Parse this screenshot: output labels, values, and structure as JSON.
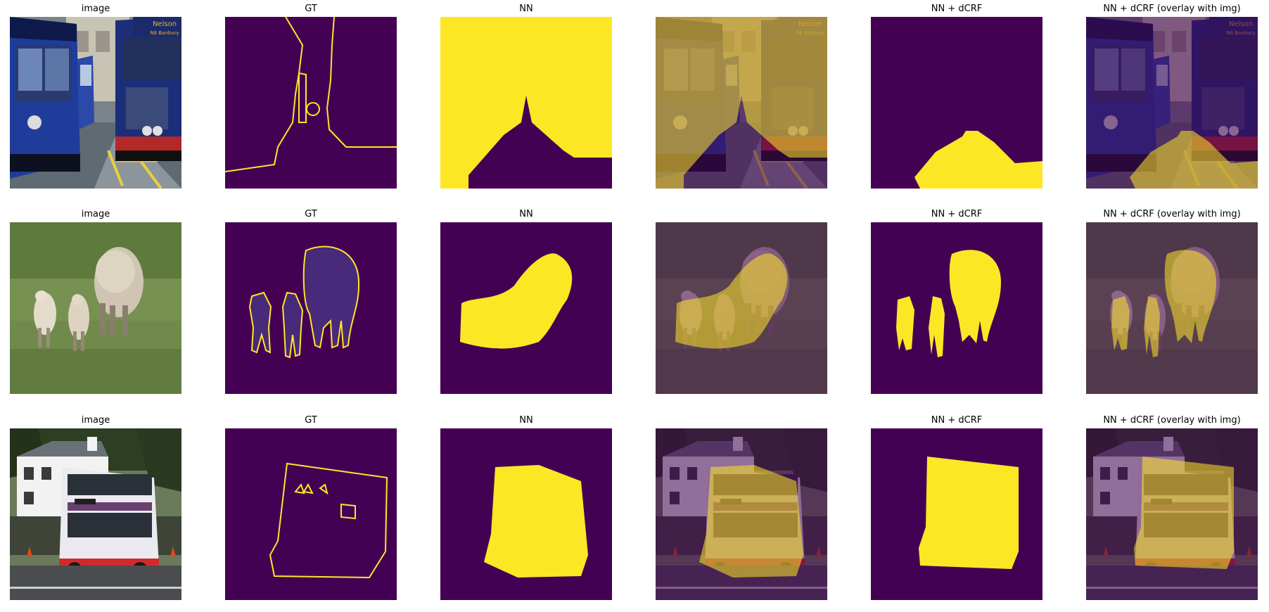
{
  "figure": {
    "columns": [
      {
        "key": "image",
        "title": "image"
      },
      {
        "key": "gt",
        "title": "GT"
      },
      {
        "key": "nn",
        "title": "NN"
      },
      {
        "key": "nn_overlay",
        "title": ""
      },
      {
        "key": "nn_dcrf",
        "title": "NN + dCRF"
      },
      {
        "key": "nn_dcrf_overlay",
        "title": "NN + dCRF (overlay with img)"
      }
    ],
    "rows": [
      {
        "subject": "buses"
      },
      {
        "subject": "sheep"
      },
      {
        "subject": "bus"
      }
    ],
    "bus_sign_text": "Nelson",
    "bus_route_text": "N8 Banbury",
    "colors": {
      "background_class": "#440154",
      "foreground_class": "#fde725",
      "gt_background": "#440154",
      "gt_object_fill": "#472a7a",
      "gt_boundary": "#fde725"
    }
  }
}
